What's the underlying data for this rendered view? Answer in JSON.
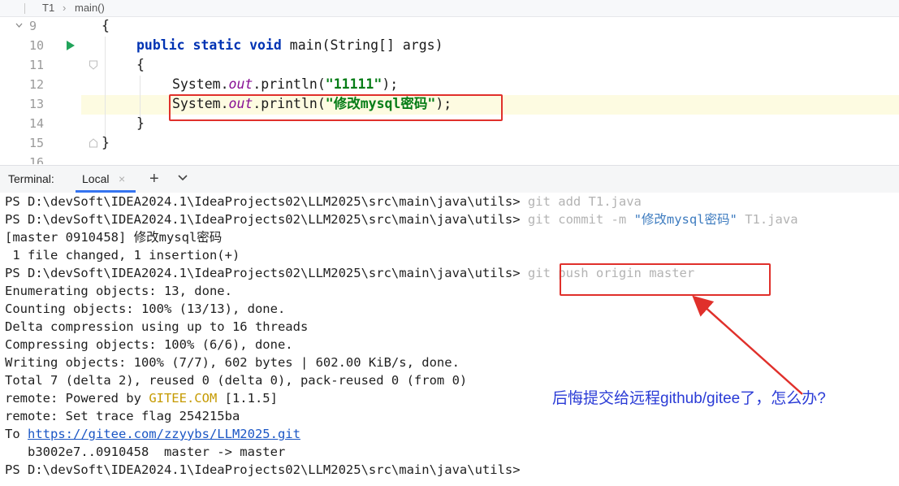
{
  "breadcrumb": {
    "file": "T1",
    "separator": "›",
    "method": "main()"
  },
  "editor": {
    "lines": [
      {
        "num": "9",
        "code": "{"
      },
      {
        "num": "10",
        "kw1": "public",
        "kw2": "static",
        "kw3": "void",
        "rest": " main(String[] args)"
      },
      {
        "num": "11",
        "code": "{"
      },
      {
        "num": "12",
        "pre": "System.",
        "field": "out",
        "mid": ".println(",
        "str": "\"11111\"",
        "post": ");"
      },
      {
        "num": "13",
        "pre": "System.",
        "field": "out",
        "mid": ".println(",
        "str": "\"修改mysql密码\"",
        "post": ");"
      },
      {
        "num": "14",
        "code": "}"
      },
      {
        "num": "15",
        "code": "}"
      },
      {
        "num": "16"
      }
    ]
  },
  "terminal_bar": {
    "label": "Terminal:",
    "tab": "Local",
    "close": "×",
    "add": "+"
  },
  "terminal": {
    "prompt": "PS D:\\devSoft\\IDEA2024.1\\IdeaProjects02\\LLM2025\\src\\main\\java\\utils> ",
    "cmd1": "git add T1.java",
    "cmd2_pre": "git commit -m ",
    "cmd2_q": "\"修改mysql密码\"",
    "cmd2_post": " T1.java",
    "out_commit": "[master 0910458] 修改mysql密码",
    "out_changed": " 1 file changed, 1 insertion(+)",
    "cmd3": "git push origin master",
    "out_enum": "Enumerating objects: 13, done.",
    "out_count": "Counting objects: 100% (13/13), done.",
    "out_delta": "Delta compression using up to 16 threads",
    "out_compress": "Compressing objects: 100% (6/6), done.",
    "out_write": "Writing objects: 100% (7/7), 602 bytes | 602.00 KiB/s, done.",
    "out_total": "Total 7 (delta 2), reused 0 (delta 0), pack-reused 0 (from 0)",
    "out_remote1_pre": "remote: Powered by ",
    "out_remote1_brand": "GITEE.COM",
    "out_remote1_post": " [1.1.5]",
    "out_remote2": "remote: Set trace flag 254215ba",
    "out_to_pre": "To ",
    "out_to_url": "https://gitee.com/zzyybs/LLM2025.git",
    "out_ref": "   b3002e7..0910458  master -> master"
  },
  "annotation": {
    "note": "后悔提交给远程github/gitee了，怎么办?"
  },
  "colors": {
    "highlight_box": "#e0302b",
    "note_text": "#2a3bd6",
    "arrow": "#e0302b",
    "tab_underline": "#3574f0"
  }
}
